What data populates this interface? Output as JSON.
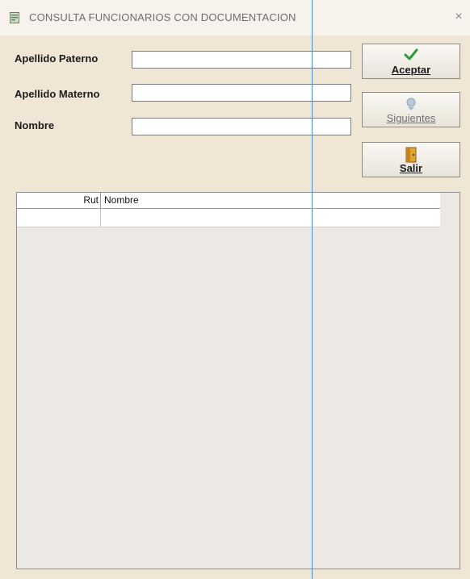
{
  "window": {
    "title": "CONSULTA FUNCIONARIOS CON DOCUMENTACION",
    "close_symbol": "×"
  },
  "form": {
    "apellido_paterno": {
      "label": "Apellido Paterno",
      "value": ""
    },
    "apellido_materno": {
      "label": "Apellido Materno",
      "value": ""
    },
    "nombre": {
      "label": "Nombre",
      "value": ""
    }
  },
  "buttons": {
    "aceptar": {
      "label": "Aceptar",
      "icon": "check-icon",
      "enabled": true
    },
    "siguientes": {
      "label": "Siguientes",
      "icon": "arrows-icon",
      "enabled": false
    },
    "salir": {
      "label": "Salir",
      "icon": "door-exit-icon",
      "enabled": true
    }
  },
  "grid": {
    "columns": [
      "Rut",
      "Nombre"
    ],
    "rows": [
      {
        "rut": "",
        "nombre": ""
      }
    ]
  },
  "colors": {
    "accent_check": "#2f9a3a",
    "selection_line": "#4f8fd1"
  }
}
